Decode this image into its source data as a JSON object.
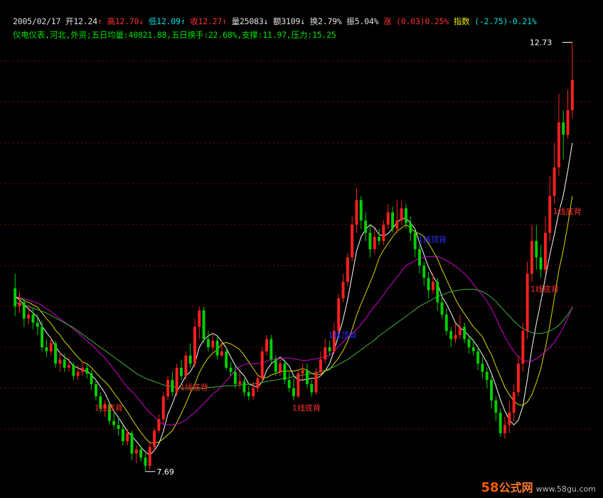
{
  "header": {
    "date": "2005/02/17",
    "open_label": "开",
    "open": "12.24",
    "high_label": "高",
    "high": "12.70",
    "low_label": "低",
    "low": "12.09",
    "close_label": "收",
    "close": "12.27",
    "vol_label": "量",
    "vol": "25083",
    "amount_label": "额",
    "amount": "3109",
    "turnover_label": "换",
    "turnover": "2.79%",
    "amplitude_label": "振",
    "amplitude": "5.04%",
    "change_label": "涨",
    "change": "(0.03)0.25%",
    "index_label": "指数",
    "index": "(-2.75)-0.21%"
  },
  "info_line": "仪电仪表,河北,外资;五日均量:40821.88,五日换手:22.68%,支撑:11.97,压力:15.25",
  "watermark": {
    "num": "58",
    "cn": "公式网",
    "url": "www.58gu.com"
  },
  "colors": {
    "up": "#ff2020",
    "down": "#00d000",
    "grid": "#8b0000",
    "ma_fast": "#ffffff",
    "ma_mid": "#d8d800",
    "ma_slow": "#d000d0",
    "ma_long": "#40b040",
    "sig_red": "#ff3030",
    "sig_blue": "#3030ff"
  },
  "chart_data": {
    "type": "candlestick",
    "price_labels": {
      "max": "12.73",
      "min": "7.69"
    },
    "candles": [
      [
        9.72,
        9.5,
        9.9,
        9.38
      ],
      [
        9.5,
        9.55,
        9.68,
        9.42
      ],
      [
        9.55,
        9.35,
        9.6,
        9.25
      ],
      [
        9.35,
        9.4,
        9.52,
        9.28
      ],
      [
        9.4,
        9.3,
        9.48,
        9.22
      ],
      [
        9.3,
        9.25,
        9.4,
        9.15
      ],
      [
        9.25,
        9.0,
        9.32,
        8.95
      ],
      [
        9.0,
        8.95,
        9.1,
        8.88
      ],
      [
        8.95,
        9.05,
        9.12,
        8.9
      ],
      [
        9.05,
        8.8,
        9.08,
        8.75
      ],
      [
        8.8,
        8.85,
        8.95,
        8.7
      ],
      [
        8.85,
        8.75,
        8.92,
        8.7
      ],
      [
        8.75,
        8.78,
        8.88,
        8.7
      ],
      [
        8.78,
        8.65,
        8.82,
        8.6
      ],
      [
        8.65,
        8.7,
        8.78,
        8.6
      ],
      [
        8.7,
        8.75,
        8.82,
        8.65
      ],
      [
        8.75,
        8.68,
        8.8,
        8.62
      ],
      [
        8.68,
        8.55,
        8.72,
        8.48
      ],
      [
        8.55,
        8.4,
        8.6,
        8.35
      ],
      [
        8.4,
        8.25,
        8.45,
        8.2
      ],
      [
        8.25,
        8.3,
        8.35,
        8.15
      ],
      [
        8.3,
        8.1,
        8.32,
        8.05
      ],
      [
        8.1,
        8.05,
        8.2,
        8.0
      ],
      [
        8.05,
        8.0,
        8.12,
        7.92
      ],
      [
        8.0,
        7.85,
        8.05,
        7.8
      ],
      [
        7.85,
        7.95,
        8.0,
        7.8
      ],
      [
        7.95,
        7.7,
        7.98,
        7.62
      ],
      [
        7.7,
        7.75,
        7.8,
        7.58
      ],
      [
        7.75,
        7.65,
        7.8,
        7.6
      ],
      [
        7.65,
        7.55,
        7.7,
        7.48
      ],
      [
        7.55,
        7.78,
        7.85,
        7.5
      ],
      [
        7.78,
        7.98,
        8.02,
        7.72
      ],
      [
        7.98,
        8.12,
        8.18,
        7.95
      ],
      [
        8.12,
        8.4,
        8.45,
        8.05
      ],
      [
        8.4,
        8.6,
        8.65,
        8.35
      ],
      [
        8.6,
        8.45,
        8.7,
        8.4
      ],
      [
        8.45,
        8.75,
        8.8,
        8.4
      ],
      [
        8.75,
        8.65,
        8.85,
        8.6
      ],
      [
        8.65,
        8.9,
        8.95,
        8.6
      ],
      [
        8.9,
        8.8,
        9.05,
        8.75
      ],
      [
        8.8,
        9.25,
        9.35,
        8.75
      ],
      [
        9.25,
        9.45,
        9.5,
        9.1
      ],
      [
        9.45,
        9.1,
        9.5,
        9.05
      ],
      [
        9.1,
        9.0,
        9.2,
        8.95
      ],
      [
        9.0,
        9.08,
        9.18,
        8.95
      ],
      [
        9.08,
        8.9,
        9.15,
        8.85
      ],
      [
        8.9,
        8.95,
        9.08,
        8.88
      ],
      [
        8.95,
        8.75,
        9.0,
        8.72
      ],
      [
        8.75,
        8.7,
        8.82,
        8.65
      ],
      [
        8.7,
        8.55,
        8.78,
        8.5
      ],
      [
        8.55,
        8.58,
        8.7,
        8.5
      ],
      [
        8.58,
        8.45,
        8.62,
        8.4
      ],
      [
        8.45,
        8.4,
        8.52,
        8.35
      ],
      [
        8.4,
        8.5,
        8.58,
        8.36
      ],
      [
        8.5,
        8.62,
        8.65,
        8.45
      ],
      [
        8.62,
        8.95,
        9.0,
        8.58
      ],
      [
        8.95,
        9.1,
        9.15,
        8.9
      ],
      [
        9.1,
        8.85,
        9.15,
        8.8
      ],
      [
        8.85,
        8.7,
        8.9,
        8.65
      ],
      [
        8.7,
        8.8,
        8.85,
        8.65
      ],
      [
        8.8,
        8.6,
        8.85,
        8.55
      ],
      [
        8.6,
        8.5,
        8.7,
        8.45
      ],
      [
        8.5,
        8.4,
        8.62,
        8.35
      ],
      [
        8.4,
        8.68,
        8.72,
        8.38
      ],
      [
        8.68,
        8.72,
        8.8,
        8.6
      ],
      [
        8.72,
        8.55,
        8.8,
        8.5
      ],
      [
        8.55,
        8.45,
        8.6,
        8.4
      ],
      [
        8.45,
        8.7,
        8.75,
        8.42
      ],
      [
        8.7,
        8.85,
        8.95,
        8.65
      ],
      [
        8.85,
        9.0,
        9.1,
        8.8
      ],
      [
        9.0,
        8.95,
        9.08,
        8.9
      ],
      [
        8.95,
        9.2,
        9.3,
        8.92
      ],
      [
        9.2,
        9.6,
        9.65,
        9.15
      ],
      [
        9.6,
        9.8,
        9.9,
        9.55
      ],
      [
        9.8,
        10.1,
        10.15,
        9.75
      ],
      [
        10.1,
        10.5,
        10.6,
        10.05
      ],
      [
        10.5,
        10.8,
        10.95,
        10.4
      ],
      [
        10.8,
        10.55,
        10.85,
        10.45
      ],
      [
        10.55,
        10.4,
        10.65,
        10.3
      ],
      [
        10.4,
        10.2,
        10.5,
        10.1
      ],
      [
        10.2,
        10.35,
        10.45,
        10.15
      ],
      [
        10.35,
        10.3,
        10.45,
        10.25
      ],
      [
        10.3,
        10.5,
        10.55,
        10.25
      ],
      [
        10.5,
        10.65,
        10.75,
        10.45
      ],
      [
        10.65,
        10.45,
        10.72,
        10.4
      ],
      [
        10.45,
        10.55,
        10.8,
        10.4
      ],
      [
        10.55,
        10.7,
        10.8,
        10.5
      ],
      [
        10.7,
        10.52,
        10.75,
        10.45
      ],
      [
        10.52,
        10.4,
        10.6,
        10.3
      ],
      [
        10.4,
        10.2,
        10.45,
        10.1
      ],
      [
        10.2,
        10.0,
        10.25,
        9.9
      ],
      [
        10.0,
        9.85,
        10.05,
        9.75
      ],
      [
        9.85,
        9.7,
        9.92,
        9.6
      ],
      [
        9.7,
        9.8,
        9.9,
        9.65
      ],
      [
        9.8,
        9.55,
        9.85,
        9.45
      ],
      [
        9.55,
        9.4,
        9.62,
        9.35
      ],
      [
        9.4,
        9.2,
        9.48,
        9.15
      ],
      [
        9.2,
        9.1,
        9.25,
        9.0
      ],
      [
        9.1,
        9.15,
        9.3,
        9.05
      ],
      [
        9.15,
        9.25,
        9.4,
        9.1
      ],
      [
        9.25,
        9.1,
        9.3,
        9.05
      ],
      [
        9.1,
        9.0,
        9.15,
        8.92
      ],
      [
        9.0,
        8.95,
        9.1,
        8.9
      ],
      [
        8.95,
        8.8,
        9.0,
        8.72
      ],
      [
        8.8,
        8.7,
        8.88,
        8.62
      ],
      [
        8.7,
        8.6,
        8.75,
        8.5
      ],
      [
        8.6,
        8.35,
        8.65,
        8.25
      ],
      [
        8.35,
        8.2,
        8.4,
        8.1
      ],
      [
        8.2,
        7.95,
        8.25,
        7.9
      ],
      [
        7.95,
        8.05,
        8.15,
        7.88
      ],
      [
        8.05,
        8.2,
        8.35,
        7.95
      ],
      [
        8.2,
        8.45,
        8.55,
        8.1
      ],
      [
        8.45,
        8.8,
        8.9,
        8.4
      ],
      [
        8.8,
        9.2,
        9.3,
        8.7
      ],
      [
        9.2,
        9.9,
        10.05,
        9.1
      ],
      [
        9.9,
        10.3,
        10.5,
        9.8
      ],
      [
        10.3,
        10.1,
        10.5,
        9.95
      ],
      [
        10.1,
        9.95,
        10.25,
        9.85
      ],
      [
        9.95,
        10.4,
        10.6,
        9.9
      ],
      [
        10.4,
        10.85,
        11.1,
        10.3
      ],
      [
        10.85,
        11.2,
        11.5,
        10.75
      ],
      [
        11.2,
        11.75,
        12.1,
        11.1
      ],
      [
        11.75,
        11.6,
        11.9,
        11.3
      ],
      [
        11.6,
        11.9,
        12.15,
        11.55
      ],
      [
        11.9,
        12.27,
        12.73,
        11.8
      ]
    ],
    "ma": [
      {
        "name": "MA5",
        "color": "#ffffff",
        "values": [
          9.62,
          9.58,
          9.52,
          9.47,
          9.42,
          9.37,
          9.26,
          9.18,
          9.11,
          9.01,
          8.93,
          8.88,
          8.84,
          8.77,
          8.75,
          8.72,
          8.71,
          8.66,
          8.6,
          8.52,
          8.44,
          8.32,
          8.22,
          8.14,
          8.06,
          7.97,
          7.91,
          7.85,
          7.78,
          7.72,
          7.68,
          7.74,
          7.82,
          7.97,
          8.18,
          8.31,
          8.46,
          8.55,
          8.65,
          8.7,
          8.8,
          9.0,
          9.09,
          9.14,
          9.17,
          9.14,
          9.07,
          8.99,
          8.88,
          8.78,
          8.71,
          8.65,
          8.55,
          8.53,
          8.51,
          8.58,
          8.72,
          8.8,
          8.84,
          8.88,
          8.83,
          8.77,
          8.65,
          8.6,
          8.6,
          8.61,
          8.62,
          8.62,
          8.65,
          8.71,
          8.8,
          8.96,
          9.15,
          9.34,
          9.58,
          9.88,
          10.18,
          10.35,
          10.44,
          10.5,
          10.46,
          10.38,
          10.36,
          10.39,
          10.45,
          10.53,
          10.57,
          10.58,
          10.52,
          10.45,
          10.28,
          10.13,
          9.98,
          9.87,
          9.78,
          9.62,
          9.53,
          9.42,
          9.3,
          9.24,
          9.2,
          9.14,
          9.08,
          9.0,
          8.91,
          8.81,
          8.68,
          8.53,
          8.36,
          8.22,
          8.11,
          8.05,
          8.11,
          8.28,
          8.61,
          8.99,
          9.29,
          9.56,
          9.85,
          10.13,
          10.38,
          10.65,
          10.86,
          11.16,
          11.5
        ]
      },
      {
        "name": "MA10",
        "color": "#d8d800",
        "values": [
          9.62,
          9.6,
          9.57,
          9.55,
          9.52,
          9.49,
          9.42,
          9.35,
          9.29,
          9.21,
          9.15,
          9.07,
          9.01,
          8.94,
          8.88,
          8.82,
          8.8,
          8.75,
          8.69,
          8.63,
          8.58,
          8.52,
          8.44,
          8.37,
          8.29,
          8.21,
          8.12,
          8.04,
          7.96,
          7.89,
          7.83,
          7.83,
          7.84,
          7.88,
          7.93,
          7.98,
          8.08,
          8.19,
          8.31,
          8.44,
          8.55,
          8.69,
          8.79,
          8.87,
          8.93,
          8.97,
          9.04,
          9.06,
          9.04,
          9.01,
          8.97,
          8.9,
          8.82,
          8.74,
          8.66,
          8.62,
          8.63,
          8.66,
          8.68,
          8.7,
          8.71,
          8.71,
          8.71,
          8.72,
          8.74,
          8.72,
          8.68,
          8.66,
          8.67,
          8.71,
          8.73,
          8.8,
          8.87,
          8.96,
          9.07,
          9.22,
          9.39,
          9.53,
          9.66,
          9.79,
          9.93,
          10.09,
          10.19,
          10.27,
          10.35,
          10.42,
          10.46,
          10.5,
          10.46,
          10.41,
          10.39,
          10.35,
          10.27,
          10.18,
          10.08,
          9.95,
          9.83,
          9.71,
          9.59,
          9.49,
          9.41,
          9.33,
          9.25,
          9.19,
          9.13,
          9.01,
          8.91,
          8.77,
          8.64,
          8.51,
          8.42,
          8.34,
          8.3,
          8.29,
          8.33,
          8.42,
          8.57,
          8.74,
          8.99,
          9.27,
          9.6,
          9.94,
          10.19,
          10.5,
          10.85
        ]
      },
      {
        "name": "MA20",
        "color": "#d000d0",
        "values": [
          9.62,
          9.61,
          9.59,
          9.58,
          9.56,
          9.54,
          9.51,
          9.47,
          9.44,
          9.39,
          9.35,
          9.31,
          9.27,
          9.22,
          9.18,
          9.13,
          9.08,
          9.03,
          8.98,
          8.92,
          8.87,
          8.8,
          8.73,
          8.66,
          8.58,
          8.51,
          8.46,
          8.4,
          8.33,
          8.26,
          8.2,
          8.15,
          8.09,
          8.06,
          8.05,
          8.05,
          8.06,
          8.08,
          8.11,
          8.16,
          8.2,
          8.26,
          8.31,
          8.37,
          8.43,
          8.47,
          8.53,
          8.59,
          8.65,
          8.72,
          8.76,
          8.79,
          8.8,
          8.8,
          8.8,
          8.81,
          8.83,
          8.85,
          8.86,
          8.86,
          8.87,
          8.87,
          8.86,
          8.85,
          8.84,
          8.84,
          8.85,
          8.86,
          8.87,
          8.89,
          8.9,
          8.95,
          9.01,
          9.07,
          9.12,
          9.17,
          9.22,
          9.28,
          9.35,
          9.43,
          9.5,
          9.57,
          9.64,
          9.72,
          9.79,
          9.86,
          9.93,
          10.0,
          10.03,
          10.06,
          10.09,
          10.1,
          10.11,
          10.11,
          10.11,
          10.09,
          10.06,
          10.03,
          9.99,
          9.95,
          9.9,
          9.84,
          9.77,
          9.7,
          9.64,
          9.56,
          9.47,
          9.36,
          9.24,
          9.13,
          9.03,
          8.95,
          8.88,
          8.84,
          8.83,
          8.83,
          8.86,
          8.9,
          8.95,
          9.0,
          9.06,
          9.15,
          9.24,
          9.36,
          9.5
        ]
      },
      {
        "name": "MA60",
        "color": "#40b040",
        "values": [
          9.55,
          9.53,
          9.52,
          9.5,
          9.48,
          9.46,
          9.44,
          9.42,
          9.39,
          9.36,
          9.33,
          9.3,
          9.27,
          9.24,
          9.2,
          9.16,
          9.12,
          9.08,
          9.04,
          9.0,
          8.96,
          8.92,
          8.88,
          8.84,
          8.8,
          8.76,
          8.72,
          8.68,
          8.65,
          8.62,
          8.6,
          8.58,
          8.56,
          8.54,
          8.53,
          8.52,
          8.51,
          8.5,
          8.5,
          8.5,
          8.5,
          8.5,
          8.5,
          8.51,
          8.51,
          8.52,
          8.52,
          8.53,
          8.53,
          8.53,
          8.54,
          8.54,
          8.55,
          8.55,
          8.56,
          8.57,
          8.58,
          8.59,
          8.6,
          8.61,
          8.62,
          8.63,
          8.64,
          8.65,
          8.66,
          8.67,
          8.68,
          8.69,
          8.7,
          8.72,
          8.74,
          8.76,
          8.79,
          8.82,
          8.85,
          8.89,
          8.93,
          8.97,
          9.01,
          9.05,
          9.09,
          9.14,
          9.18,
          9.22,
          9.26,
          9.3,
          9.34,
          9.38,
          9.42,
          9.46,
          9.5,
          9.53,
          9.56,
          9.59,
          9.62,
          9.64,
          9.66,
          9.68,
          9.69,
          9.7,
          9.71,
          9.71,
          9.71,
          9.7,
          9.68,
          9.65,
          9.61,
          9.56,
          9.5,
          9.44,
          9.38,
          9.32,
          9.27,
          9.23,
          9.2,
          9.18,
          9.17,
          9.17,
          9.18,
          9.2,
          9.23,
          9.27,
          9.33,
          9.4,
          9.48
        ]
      }
    ],
    "signals": [
      {
        "i": 18,
        "text": "1线底背",
        "color": "#ff3030"
      },
      {
        "i": 37,
        "text": "1线底背",
        "color": "#ff3030"
      },
      {
        "i": 62,
        "text": "1线底背",
        "color": "#ff3030"
      },
      {
        "i": 70,
        "text": "1线顶背",
        "color": "#3030ff",
        "above": true
      },
      {
        "i": 90,
        "text": "1线顶背",
        "color": "#3030ff",
        "above": true
      },
      {
        "i": 115,
        "text": "1线底背",
        "color": "#ff3030"
      },
      {
        "i": 120,
        "text": "1线底背",
        "color": "#ff3030"
      }
    ],
    "y_range": [
      7.4,
      12.9
    ],
    "grid_values": [
      8.0,
      8.5,
      9.0,
      9.5,
      10.0,
      10.5,
      11.0,
      11.5,
      12.0,
      12.5
    ]
  }
}
